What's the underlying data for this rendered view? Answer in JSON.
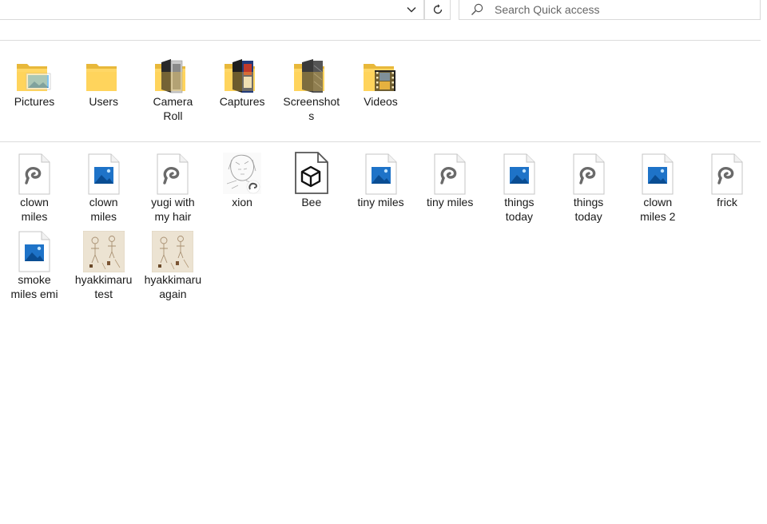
{
  "search": {
    "placeholder": "Search Quick access"
  },
  "frequent_folders": [
    {
      "label_lines": [
        "Pictures"
      ],
      "icon": "pictures-folder-icon"
    },
    {
      "label_lines": [
        "Users"
      ],
      "icon": "folder-icon"
    },
    {
      "label_lines": [
        "Camera",
        "Roll"
      ],
      "icon": "camera-roll-folder-icon"
    },
    {
      "label_lines": [
        "Captures"
      ],
      "icon": "captures-folder-icon"
    },
    {
      "label_lines": [
        "Screenshot",
        "s"
      ],
      "icon": "screenshots-folder-icon"
    },
    {
      "label_lines": [
        "Videos"
      ],
      "icon": "videos-folder-icon"
    }
  ],
  "recent_files": [
    {
      "label_lines": [
        "clown",
        "miles"
      ],
      "icon": "clip-studio-file-icon"
    },
    {
      "label_lines": [
        "clown",
        "miles"
      ],
      "icon": "image-file-icon"
    },
    {
      "label_lines": [
        "yugi with",
        "my hair"
      ],
      "icon": "clip-studio-file-icon"
    },
    {
      "label_lines": [
        "xion"
      ],
      "icon": "sketch-thumbnail-icon"
    },
    {
      "label_lines": [
        "Bee"
      ],
      "icon": "3d-object-file-icon"
    },
    {
      "label_lines": [
        "tiny miles"
      ],
      "icon": "image-file-icon"
    },
    {
      "label_lines": [
        "tiny miles"
      ],
      "icon": "clip-studio-file-icon"
    },
    {
      "label_lines": [
        "things",
        "today"
      ],
      "icon": "image-file-icon"
    },
    {
      "label_lines": [
        "things",
        "today"
      ],
      "icon": "clip-studio-file-icon"
    },
    {
      "label_lines": [
        "clown",
        "miles 2"
      ],
      "icon": "image-file-icon"
    },
    {
      "label_lines": [
        "frick"
      ],
      "icon": "clip-studio-file-icon"
    },
    {
      "label_lines": [
        "smoke",
        "miles emi"
      ],
      "icon": "image-file-icon"
    },
    {
      "label_lines": [
        "hyakkimaru",
        "test"
      ],
      "icon": "drawing-thumbnail-icon"
    },
    {
      "label_lines": [
        "hyakkimaru",
        "again"
      ],
      "icon": "drawing-thumbnail-icon"
    }
  ]
}
